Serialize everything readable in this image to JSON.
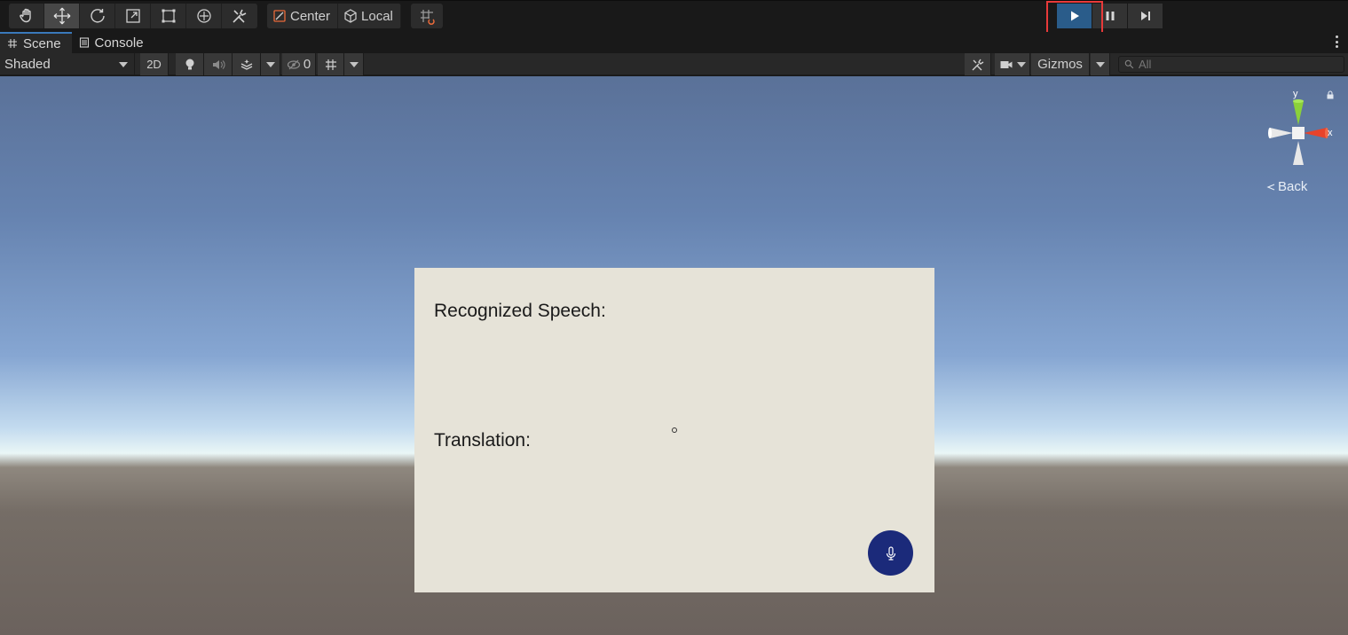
{
  "toolbar": {
    "tools": [
      {
        "name": "hand-tool",
        "icon": "hand-icon"
      },
      {
        "name": "move-tool",
        "icon": "move-icon",
        "active": true
      },
      {
        "name": "rotate-tool",
        "icon": "rotate-icon"
      },
      {
        "name": "scale-tool",
        "icon": "scale-icon"
      },
      {
        "name": "rect-tool",
        "icon": "rect-transform-icon"
      },
      {
        "name": "transform-tool",
        "icon": "transform-icon"
      },
      {
        "name": "custom-tool",
        "icon": "custom-tools-icon"
      }
    ],
    "pivot_mode_label": "Center",
    "pivot_rotation_label": "Local",
    "grid_snap_icon": "grid-snap-icon",
    "play_controls": {
      "play_icon": "play-icon",
      "pause_icon": "pause-icon",
      "step_icon": "step-icon",
      "play_active": true
    }
  },
  "tabs": [
    {
      "label": "Scene",
      "icon": "scene-hash-icon",
      "active": true
    },
    {
      "label": "Console",
      "icon": "console-icon",
      "active": false
    }
  ],
  "scene_toolbar": {
    "draw_mode": "Shaded",
    "toggle_2d_label": "2D",
    "hidden_count": "0",
    "gizmos_label": "Gizmos",
    "search_placeholder": "All"
  },
  "scene": {
    "panel": {
      "recognized_label": "Recognized Speech:",
      "translation_label": "Translation:",
      "mic_icon": "microphone-icon"
    },
    "gizmo": {
      "y_label": "y",
      "x_label": "x",
      "back_label": "Back"
    }
  },
  "colors": {
    "play_active": "#2a5c8a",
    "highlight": "#e83a3a",
    "panel_bg": "#e6e3d8",
    "mic_button": "#1b2a7a",
    "gizmo_y": "#8bd13a",
    "gizmo_x": "#e8432b"
  }
}
